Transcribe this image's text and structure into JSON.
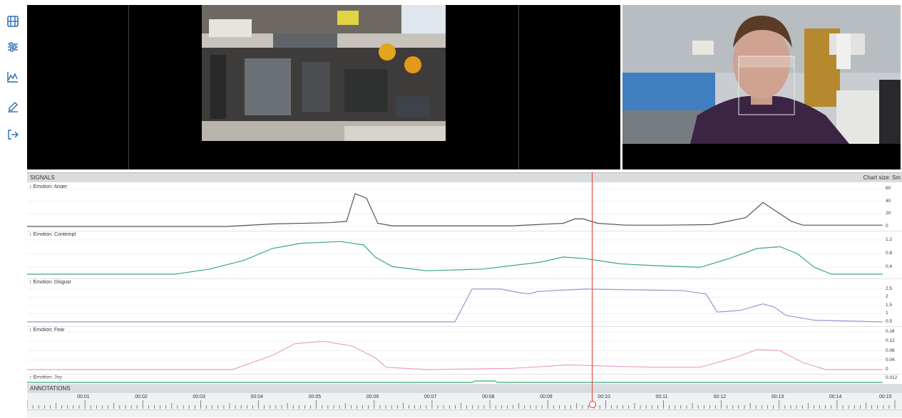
{
  "sidebar": {
    "icons": [
      "film-icon",
      "sliders-icon",
      "chart-line-icon",
      "pencil-icon",
      "logout-icon"
    ],
    "accent": "#2b6cb0"
  },
  "signals": {
    "title": "SIGNALS",
    "chart_size_label": "Chart size: Sm"
  },
  "annotations": {
    "title": "ANNOTATIONS"
  },
  "playhead": {
    "color": "#e53935"
  },
  "chart_data": {
    "type": "line",
    "x_unit": "seconds",
    "xlim": [
      0,
      15
    ],
    "timeline_labels": [
      "00:01",
      "00:02",
      "00:03",
      "00:04",
      "00:05",
      "00:06",
      "00:07",
      "00:08",
      "00:09",
      "00:10",
      "00:11",
      "00:12",
      "00:13",
      "00:14",
      "00:15"
    ],
    "playhead_time": 9.72,
    "series": [
      {
        "name": "Emotion: Anger",
        "color": "#555555",
        "yticks": [
          "60",
          "40",
          "20",
          "0"
        ],
        "ylim": [
          0,
          60
        ],
        "points": [
          [
            0,
            0
          ],
          [
            3.5,
            0
          ],
          [
            4.3,
            4
          ],
          [
            5.3,
            6
          ],
          [
            5.6,
            8
          ],
          [
            5.75,
            52
          ],
          [
            5.95,
            45
          ],
          [
            6.15,
            5
          ],
          [
            6.4,
            1
          ],
          [
            8.5,
            1
          ],
          [
            9.4,
            5
          ],
          [
            9.6,
            12
          ],
          [
            9.75,
            12
          ],
          [
            10,
            5
          ],
          [
            10.5,
            2
          ],
          [
            11.2,
            2
          ],
          [
            12,
            3
          ],
          [
            12.6,
            14
          ],
          [
            12.9,
            38
          ],
          [
            13.1,
            26
          ],
          [
            13.4,
            8
          ],
          [
            13.6,
            2
          ],
          [
            15,
            2
          ]
        ]
      },
      {
        "name": "Emotion: Contempt",
        "color": "#3aa87a",
        "yticks": [
          "1.2",
          "0.8",
          "0.4"
        ],
        "ylim": [
          0.2,
          1.3
        ],
        "points": [
          [
            0,
            0.2
          ],
          [
            2.6,
            0.2
          ],
          [
            3.2,
            0.35
          ],
          [
            3.8,
            0.6
          ],
          [
            4.3,
            0.95
          ],
          [
            4.8,
            1.1
          ],
          [
            5.5,
            1.15
          ],
          [
            5.9,
            1.05
          ],
          [
            6.1,
            0.7
          ],
          [
            6.4,
            0.42
          ],
          [
            7,
            0.3
          ],
          [
            8,
            0.35
          ],
          [
            9,
            0.55
          ],
          [
            9.4,
            0.7
          ],
          [
            9.8,
            0.65
          ],
          [
            10.4,
            0.5
          ],
          [
            11,
            0.45
          ],
          [
            11.8,
            0.4
          ],
          [
            12.3,
            0.65
          ],
          [
            12.8,
            0.95
          ],
          [
            13.2,
            1.0
          ],
          [
            13.5,
            0.8
          ],
          [
            13.8,
            0.4
          ],
          [
            14.1,
            0.2
          ],
          [
            15,
            0.2
          ]
        ]
      },
      {
        "name": "Emotion: Disgust",
        "color": "#a58fcf",
        "yticks": [
          "2.5",
          "2",
          "1.5",
          "1",
          "0.5"
        ],
        "ylim": [
          0.5,
          2.8
        ],
        "points": [
          [
            0,
            0.5
          ],
          [
            7.5,
            0.5
          ],
          [
            7.8,
            2.5
          ],
          [
            8.3,
            2.5
          ],
          [
            8.6,
            2.3
          ],
          [
            8.8,
            2.2
          ],
          [
            8.95,
            2.35
          ],
          [
            9.2,
            2.4
          ],
          [
            9.8,
            2.5
          ],
          [
            11.5,
            2.4
          ],
          [
            11.9,
            2.2
          ],
          [
            12.1,
            1.1
          ],
          [
            12.5,
            1.2
          ],
          [
            12.9,
            1.6
          ],
          [
            13.1,
            1.4
          ],
          [
            13.3,
            0.9
          ],
          [
            13.8,
            0.6
          ],
          [
            15,
            0.5
          ]
        ]
      },
      {
        "name": "Emotion: Fear",
        "color": "#e8a0c8",
        "yticks": [
          "0.16",
          "0.12",
          "0.08",
          "0.04",
          "0"
        ],
        "ylim": [
          0,
          0.16
        ],
        "points": [
          [
            0,
            0
          ],
          [
            3.6,
            0
          ],
          [
            4.3,
            0.06
          ],
          [
            4.7,
            0.11
          ],
          [
            5.2,
            0.12
          ],
          [
            5.7,
            0.1
          ],
          [
            6.1,
            0.05
          ],
          [
            6.3,
            0.01
          ],
          [
            7,
            0
          ],
          [
            8.5,
            0.005
          ],
          [
            9.5,
            0.02
          ],
          [
            10.1,
            0.015
          ],
          [
            11,
            0.01
          ],
          [
            11.8,
            0.01
          ],
          [
            12.4,
            0.05
          ],
          [
            12.8,
            0.085
          ],
          [
            13.2,
            0.08
          ],
          [
            13.6,
            0.03
          ],
          [
            14,
            0
          ],
          [
            15,
            0
          ]
        ]
      },
      {
        "name": "Emotion: Joy",
        "color": "#3aa87a",
        "yticks": [
          "0.012"
        ],
        "ylim": [
          0,
          0.012
        ],
        "points": [
          [
            0,
            0
          ],
          [
            7.8,
            0
          ],
          [
            7.85,
            0.006
          ],
          [
            8.2,
            0.006
          ],
          [
            8.25,
            0
          ],
          [
            15,
            0
          ]
        ]
      }
    ]
  }
}
